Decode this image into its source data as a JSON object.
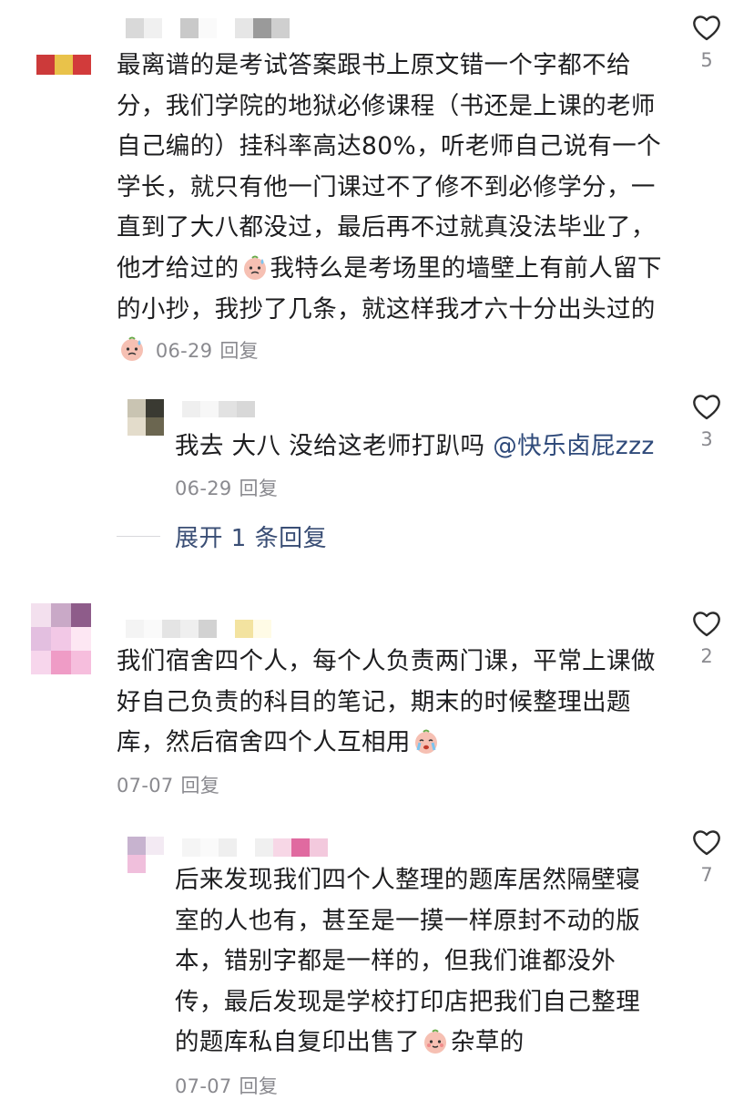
{
  "comments": [
    {
      "text_parts": [
        "最离谱的是考试答案跟书上原文错一个字都不给分，我们学院的地狱必修课程（书还是上课的老师自己编的）挂科率高达80%，听老师自己说有一个学长，就只有他一门课过不了修不到必修学分，一直到了大八都没过，最后再不过就真没法毕业了，他才给过的",
        "我特么是考场里的墙壁上有前人留下的小抄，我抄了几条，就这样我才六十分出头过的",
        ""
      ],
      "date": "06-29",
      "reply_label": "回复",
      "likes": "5",
      "reply": {
        "text": "我去 大八 没给这老师打趴吗 ",
        "mention": "@快乐卤屁zzz",
        "date": "06-29",
        "reply_label": "回复",
        "likes": "3"
      },
      "expand_label": "展开 1 条回复"
    },
    {
      "text": "我们宿舍四个人，每个人负责两门课，平常上课做好自己负责的科目的笔记，期末的时候整理出题库，然后宿舍四个人互相用",
      "date": "07-07",
      "reply_label": "回复",
      "likes": "2",
      "reply": {
        "text": "后来发现我们四个人整理的题库居然隔壁寝室的人也有，甚至是一摸一样原封不动的版本，错别字都是一样的，但我们谁都没外传，最后发现是学校打印店把我们自己整理的题库私自复印出售了",
        "tail": "杂草的",
        "date": "07-07",
        "reply_label": "回复",
        "likes": "7"
      }
    }
  ],
  "icons": {
    "like": "heart-outline-icon",
    "emoji": "peach-sweat-emoji"
  },
  "colors": {
    "text": "#1d1d1f",
    "meta": "#8a8a8f",
    "mention": "#2f4a7a",
    "expand": "#3a4e75"
  }
}
